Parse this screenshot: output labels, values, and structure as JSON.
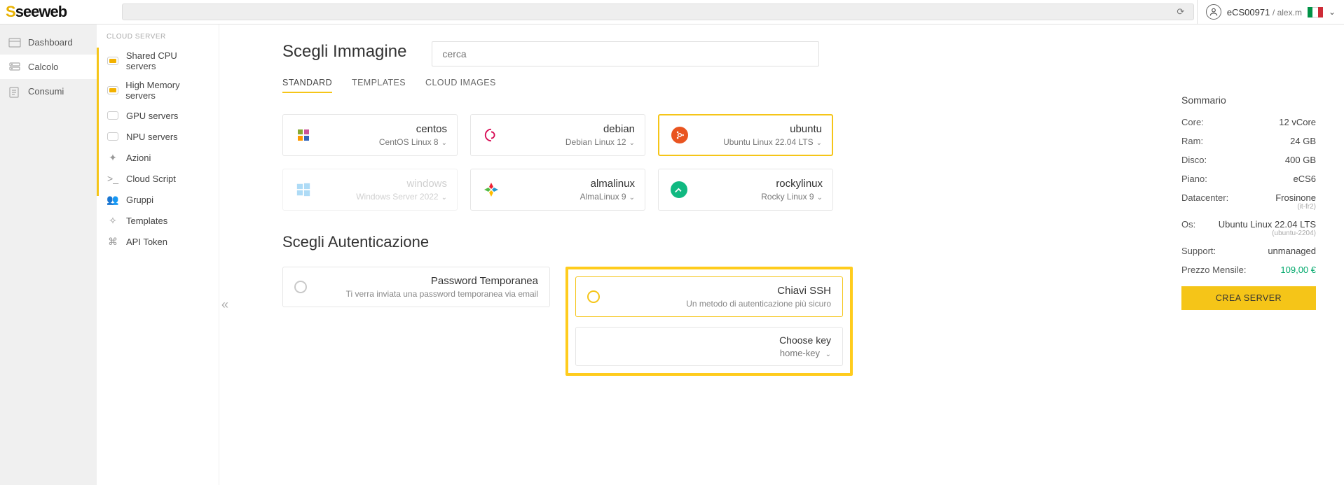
{
  "brand": "seeweb",
  "account": {
    "code": "eCS00971",
    "user": "alex.m"
  },
  "search_placeholder": "cerca",
  "sidebar": {
    "items": [
      {
        "label": "Dashboard"
      },
      {
        "label": "Calcolo"
      },
      {
        "label": "Consumi"
      }
    ]
  },
  "subnav": {
    "header": "CLOUD SERVER",
    "items": [
      {
        "label": "Shared CPU servers"
      },
      {
        "label": "High Memory servers"
      },
      {
        "label": "GPU servers"
      },
      {
        "label": "NPU servers"
      },
      {
        "label": "Azioni"
      },
      {
        "label": "Cloud Script"
      },
      {
        "label": "Gruppi"
      },
      {
        "label": "Templates"
      },
      {
        "label": "API Token"
      }
    ]
  },
  "image_section": {
    "title": "Scegli Immagine",
    "tabs": [
      "STANDARD",
      "TEMPLATES",
      "CLOUD IMAGES"
    ],
    "active_tab": 0,
    "os": [
      {
        "name": "centos",
        "version": "CentOS Linux 8",
        "selected": false,
        "disabled": false
      },
      {
        "name": "debian",
        "version": "Debian Linux 12",
        "selected": false,
        "disabled": false
      },
      {
        "name": "ubuntu",
        "version": "Ubuntu Linux 22.04 LTS",
        "selected": true,
        "disabled": false
      },
      {
        "name": "windows",
        "version": "Windows Server 2022",
        "selected": false,
        "disabled": true
      },
      {
        "name": "almalinux",
        "version": "AlmaLinux 9",
        "selected": false,
        "disabled": false
      },
      {
        "name": "rockylinux",
        "version": "Rocky Linux 9",
        "selected": false,
        "disabled": false
      }
    ]
  },
  "auth_section": {
    "title": "Scegli Autenticazione",
    "password": {
      "name": "Password Temporanea",
      "sub": "Ti verra inviata una password temporanea via email"
    },
    "ssh": {
      "name": "Chiavi SSH",
      "sub": "Un metodo di autenticazione più sicuro"
    },
    "choose_key": {
      "title": "Choose key",
      "value": "home-key"
    }
  },
  "summary": {
    "title": "Sommario",
    "rows": {
      "core": {
        "lbl": "Core:",
        "val": "12 vCore"
      },
      "ram": {
        "lbl": "Ram:",
        "val": "24 GB"
      },
      "disco": {
        "lbl": "Disco:",
        "val": "400 GB"
      },
      "piano": {
        "lbl": "Piano:",
        "val": "eCS6"
      },
      "dc": {
        "lbl": "Datacenter:",
        "val": "Frosinone",
        "tiny": "(it-fr2)"
      },
      "os": {
        "lbl": "Os:",
        "val": "Ubuntu Linux 22.04 LTS",
        "tiny": "(ubuntu-2204)"
      },
      "support": {
        "lbl": "Support:",
        "val": "unmanaged"
      }
    },
    "price": {
      "lbl": "Prezzo Mensile:",
      "val": "109,00 €"
    },
    "cta": "CREA SERVER"
  }
}
